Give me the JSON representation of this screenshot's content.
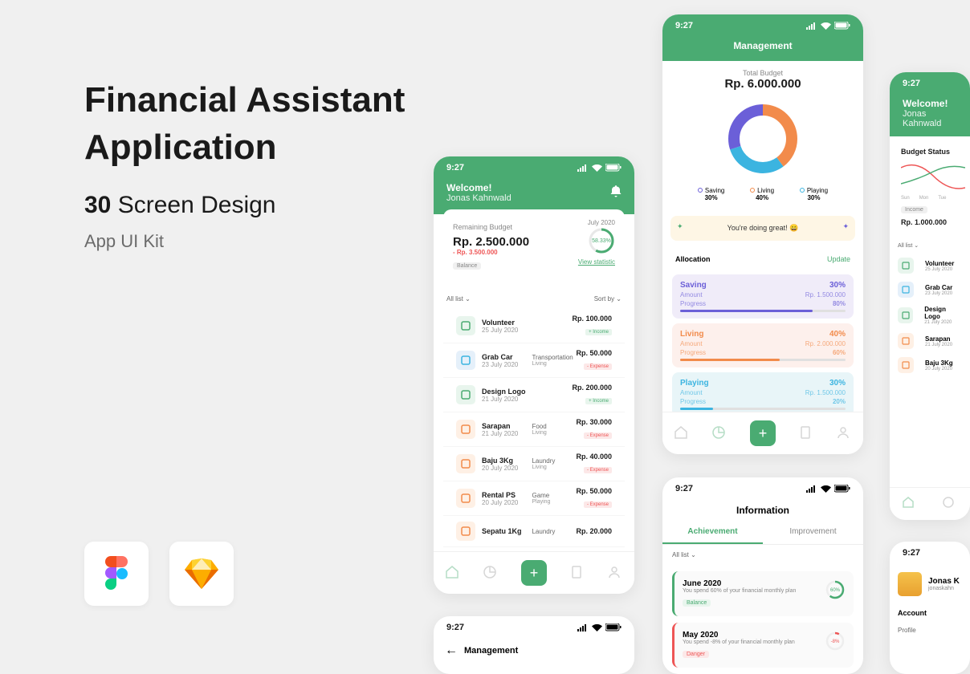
{
  "hero": {
    "title_line1": "Financial Assistant",
    "title_line2": "Application",
    "count": "30",
    "subtitle": "Screen Design",
    "tagline": "App UI Kit"
  },
  "status_time": "9:27",
  "phone1": {
    "welcome": "Welcome!",
    "name": "Jonas Kahnwald",
    "budget_label": "Remaining Budget",
    "date": "July 2020",
    "amount": "Rp. 2.500.000",
    "change": "- Rp. 3.500.000",
    "balance_tag": "Balance",
    "link": "View statistic",
    "percent": "58.33%",
    "all_list": "All list",
    "sort_by": "Sort by",
    "items": [
      {
        "title": "Volunteer",
        "date": "25 July 2020",
        "cat": "",
        "sub": "",
        "amount": "Rp. 100.000",
        "tag": "+ Income",
        "tagcls": "tag-income",
        "icon": "green"
      },
      {
        "title": "Grab Car",
        "date": "23 July 2020",
        "cat": "Transportation",
        "sub": "Living",
        "amount": "Rp. 50.000",
        "tag": "- Expense",
        "tagcls": "tag-expense",
        "icon": "blue"
      },
      {
        "title": "Design Logo",
        "date": "21 July 2020",
        "cat": "",
        "sub": "",
        "amount": "Rp. 200.000",
        "tag": "+ Income",
        "tagcls": "tag-income",
        "icon": "green"
      },
      {
        "title": "Sarapan",
        "date": "21 July 2020",
        "cat": "Food",
        "sub": "Living",
        "amount": "Rp. 30.000",
        "tag": "- Expense",
        "tagcls": "tag-expense",
        "icon": "orange"
      },
      {
        "title": "Baju 3Kg",
        "date": "20 July 2020",
        "cat": "Laundry",
        "sub": "Living",
        "amount": "Rp. 40.000",
        "tag": "- Expense",
        "tagcls": "tag-expense",
        "icon": "orange"
      },
      {
        "title": "Rental PS",
        "date": "20 July 2020",
        "cat": "Game",
        "sub": "Playing",
        "amount": "Rp. 50.000",
        "tag": "- Expense",
        "tagcls": "tag-expense",
        "icon": "orange"
      },
      {
        "title": "Sepatu 1Kg",
        "date": "",
        "cat": "Laundry",
        "sub": "",
        "amount": "Rp. 20.000",
        "tag": "",
        "tagcls": "",
        "icon": "orange"
      }
    ]
  },
  "phone2": {
    "title": "Management",
    "total_label": "Total Budget",
    "total_amount": "Rp. 6.000.000",
    "legend": [
      {
        "name": "Saving",
        "pct": "30%",
        "color": "#6b5fd8"
      },
      {
        "name": "Living",
        "pct": "40%",
        "color": "#f28b4b"
      },
      {
        "name": "Playing",
        "pct": "30%",
        "color": "#3bb4e0"
      }
    ],
    "banner": "You're doing great! 😄",
    "alloc_label": "Allocation",
    "update": "Update",
    "allocs": [
      {
        "name": "Saving",
        "pct": "30%",
        "amt_lbl": "Amount",
        "amt": "Rp. 1.500.000",
        "prog_lbl": "Progress",
        "prog": "80%",
        "cls": "purple",
        "color": "#6b5fd8",
        "fill": 80
      },
      {
        "name": "Living",
        "pct": "40%",
        "amt_lbl": "Amount",
        "amt": "Rp. 2.000.000",
        "prog_lbl": "Progress",
        "prog": "60%",
        "cls": "peach",
        "color": "#f28b4b",
        "fill": 60
      },
      {
        "name": "Playing",
        "pct": "30%",
        "amt_lbl": "Amount",
        "amt": "Rp. 1.500.000",
        "prog_lbl": "Progress",
        "prog": "20%",
        "cls": "cyan",
        "color": "#3bb4e0",
        "fill": 20
      }
    ]
  },
  "phone3": {
    "welcome": "Welcome!",
    "name": "Jonas Kahnwald",
    "chart_title": "Budget Status",
    "days": [
      "Sun",
      "Mon",
      "Tue"
    ],
    "income_tag": "Income",
    "income_amount": "Rp. 1.000.000",
    "all_list": "All list",
    "items": [
      {
        "title": "Volunteer",
        "date": "25 July 2020",
        "icon": "green"
      },
      {
        "title": "Grab Car",
        "date": "23 July 2020",
        "icon": "blue"
      },
      {
        "title": "Design Logo",
        "date": "21 July 2020",
        "icon": "green"
      },
      {
        "title": "Sarapan",
        "date": "21 July 2020",
        "icon": "orange"
      },
      {
        "title": "Baju 3Kg",
        "date": "20 July 2020",
        "icon": "orange"
      }
    ]
  },
  "phone4": {
    "title": "Information",
    "tab1": "Achievement",
    "tab2": "Improvement",
    "all_list": "All list",
    "items": [
      {
        "month": "June 2020",
        "desc": "You spend 60% of your financial monthly plan",
        "tag": "Balance",
        "pct": "60%",
        "cls": ""
      },
      {
        "month": "May 2020",
        "desc": "You spend -8% of your financial monthly plan",
        "tag": "Danger",
        "pct": "-8%",
        "cls": "danger"
      }
    ]
  },
  "phone5": {
    "name": "Jonas K",
    "handle": "jonaskahn",
    "section": "Account",
    "item": "Profile"
  },
  "phone6": {
    "title": "Management"
  },
  "chart_data": {
    "type": "pie",
    "title": "Total Budget",
    "series": [
      {
        "name": "Saving",
        "value": 30,
        "color": "#6b5fd8"
      },
      {
        "name": "Living",
        "value": 40,
        "color": "#f28b4b"
      },
      {
        "name": "Playing",
        "value": 30,
        "color": "#3bb4e0"
      }
    ]
  }
}
